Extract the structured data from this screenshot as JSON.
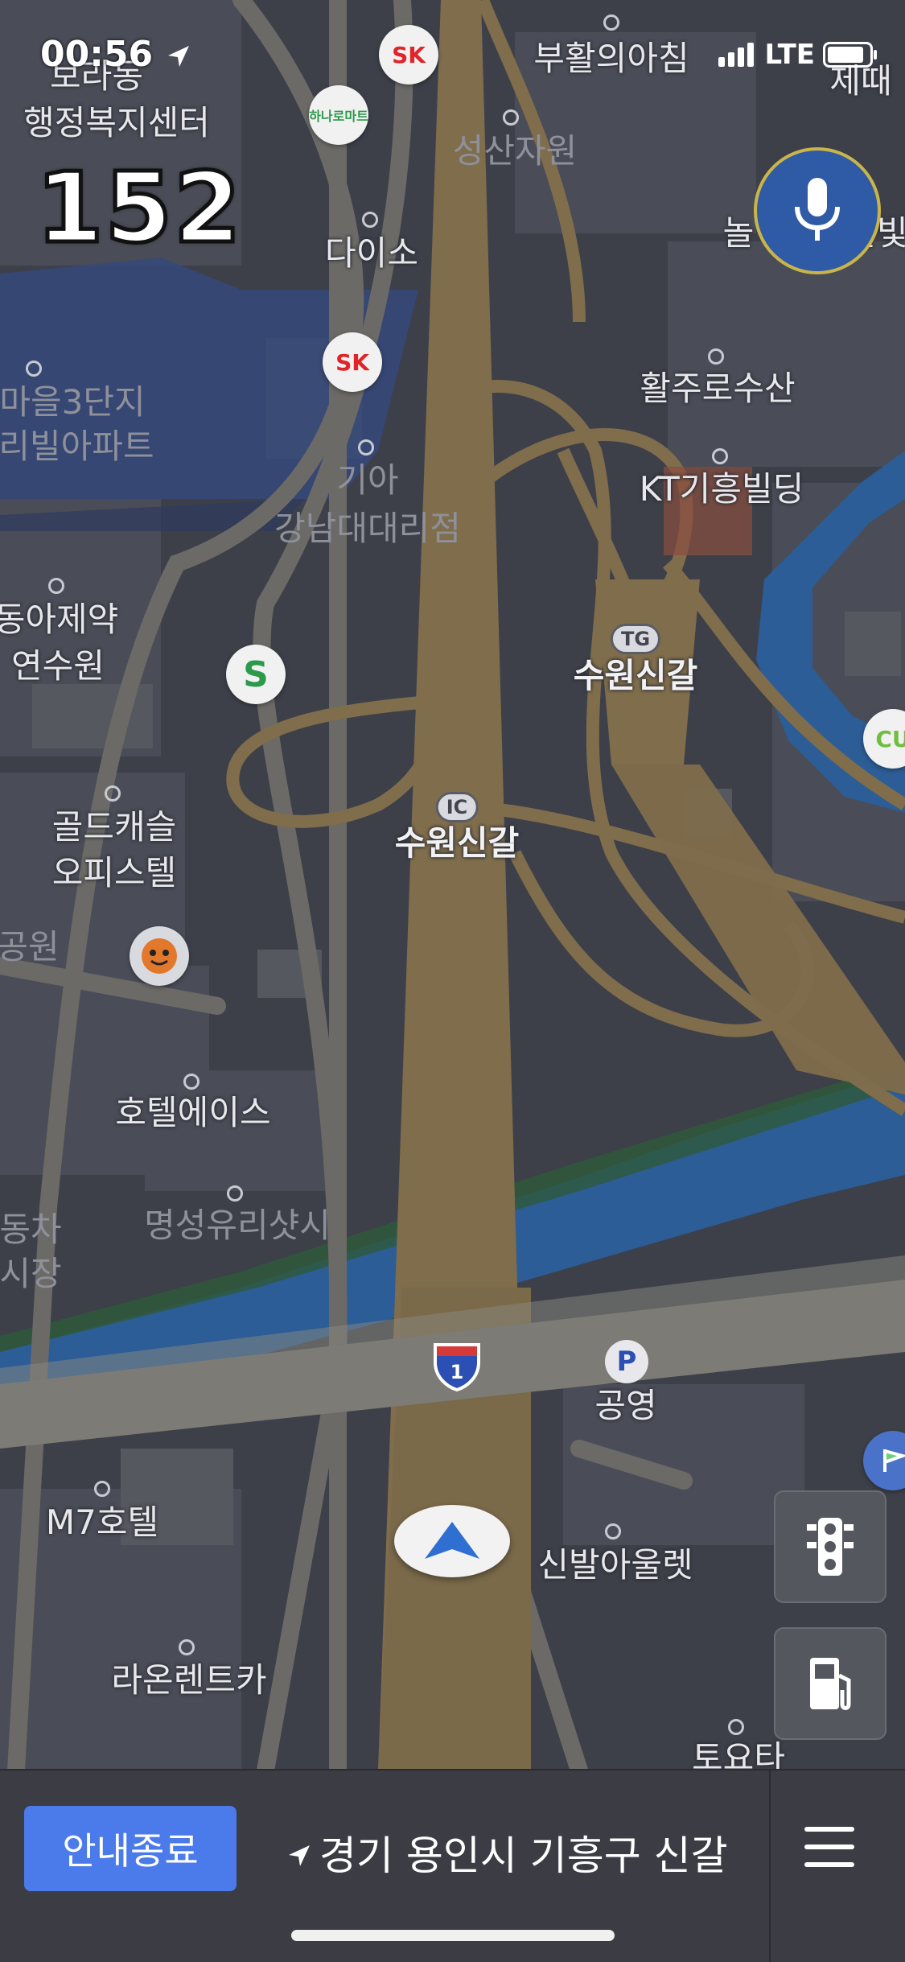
{
  "status": {
    "time": "00:56",
    "network": "LTE"
  },
  "speed": "152",
  "labels": {
    "borado": "보라동",
    "center": "행정복지센터",
    "buhwal": "부활의아침",
    "jedae": "제때",
    "seongsan": "성산자원",
    "daiso": "다이소",
    "nol": "놀",
    "pul": "폴빛",
    "maeul": "마을3단지",
    "villa": "리빌아파트",
    "hwaljuro": "활주로수산",
    "kia": "기아",
    "kia2": "강남대대리점",
    "kt": "KT기흥빌딩",
    "donga": "동아제약",
    "donga2": "연수원",
    "tg_name": "수원신갈",
    "ic_name": "수원신갈",
    "golden": "골드캐슬",
    "golden2": "오피스텔",
    "park": "공원",
    "hotel_ace": "호텔에이스",
    "car": "동차",
    "car2": "시장",
    "glass": "명성유리샷시",
    "gongyeong": "공영",
    "m7": "M7호텔",
    "sinbal": "신발아울렛",
    "rent": "라온렌트카",
    "toyota": "토요타"
  },
  "badges": {
    "tg": "TG",
    "ic": "IC",
    "route": "1",
    "parking": "P"
  },
  "pois": {
    "sk": "SK",
    "hanaro": "하나로마트",
    "s": "S",
    "cu": "CU"
  },
  "bottom": {
    "end_button": "안내종료",
    "address": "경기 용인시 기흥구 신갈"
  },
  "icons": [
    "location-arrow-icon",
    "microphone-icon",
    "traffic-light-icon",
    "gas-station-icon",
    "menu-icon",
    "navigation-arrow-icon"
  ],
  "colors": {
    "road": "#7f6d4c",
    "water": "#2c5d96",
    "accent": "#4b7bea",
    "mic": "#2f5aa5"
  }
}
